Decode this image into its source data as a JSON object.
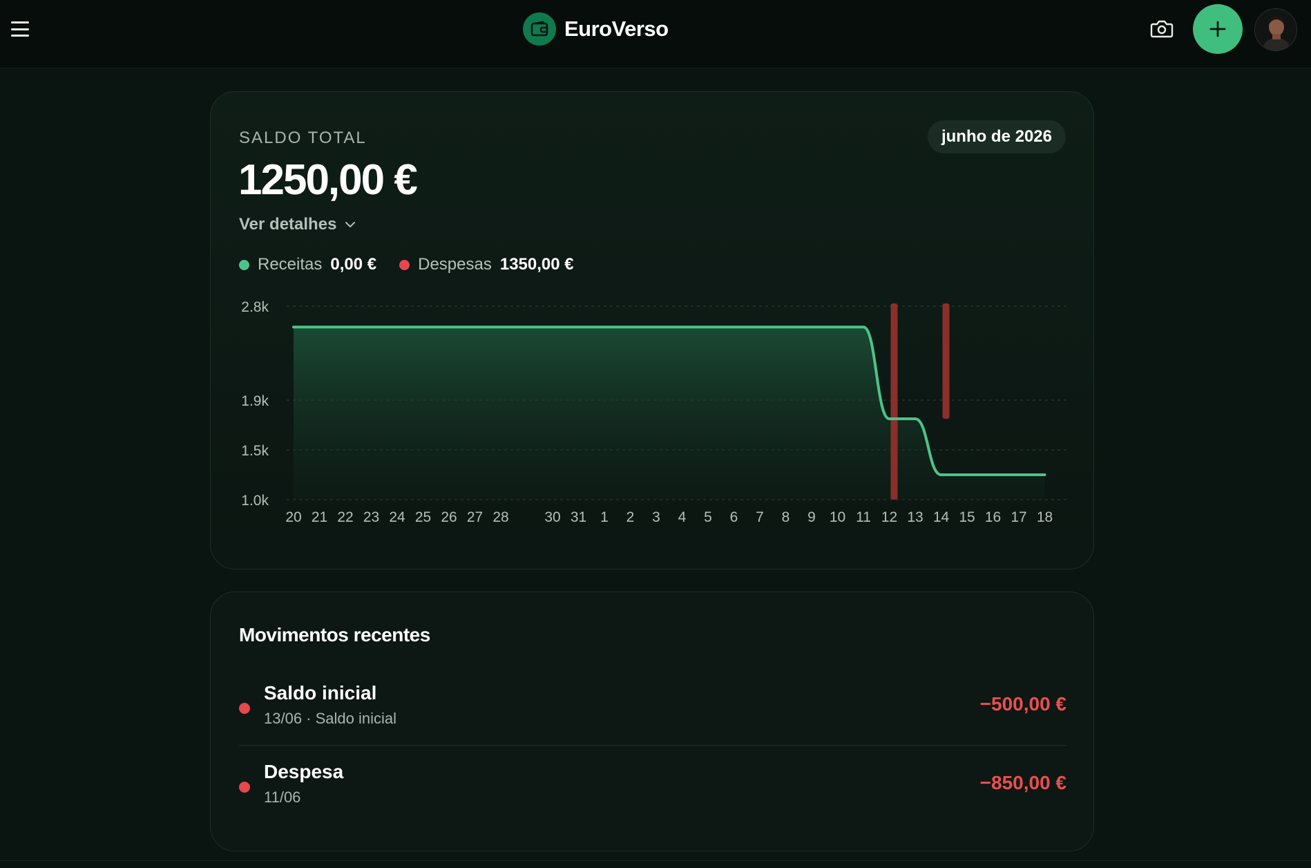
{
  "app": {
    "name": "EuroVerso",
    "accent_color": "#3fbe7d",
    "expense_color": "#e5484d"
  },
  "header": {
    "menu_icon": "hamburger-menu-icon",
    "logo_icon": "wallet-icon",
    "camera_icon": "camera-icon",
    "add_icon": "plus-icon",
    "avatar_icon": "user-avatar"
  },
  "balance": {
    "label": "SALDO TOTAL",
    "value": "1250,00 €",
    "month": "junho de 2026",
    "details_label": "Ver detalhes",
    "income_label": "Receitas",
    "income_value": "0,00 €",
    "expense_label": "Despesas",
    "expense_value": "1350,00 €"
  },
  "chart_data": {
    "type": "line",
    "title": "",
    "xlabel": "",
    "ylabel": "",
    "y_tick_labels": [
      "2.8k",
      "1.9k",
      "1.5k",
      "1.0k"
    ],
    "y_tick_values": [
      2800,
      1900,
      1500,
      1000
    ],
    "x_tick_labels": [
      "20",
      "21",
      "22",
      "23",
      "24",
      "25",
      "26",
      "27",
      "28",
      "30",
      "31",
      "1",
      "2",
      "3",
      "4",
      "5",
      "6",
      "7",
      "8",
      "9",
      "10",
      "11",
      "12",
      "13",
      "14",
      "15",
      "16",
      "17",
      "18"
    ],
    "grid": true,
    "series": [
      {
        "color": "#4cc488",
        "fill": true,
        "x": [
          "20",
          "21",
          "22",
          "23",
          "24",
          "25",
          "26",
          "27",
          "28",
          "30",
          "31",
          "1",
          "2",
          "3",
          "4",
          "5",
          "6",
          "7",
          "8",
          "9",
          "10",
          "11",
          "12",
          "13",
          "14",
          "15",
          "16",
          "17",
          "18"
        ],
        "values": [
          2600,
          2600,
          2600,
          2600,
          2600,
          2600,
          2600,
          2600,
          2600,
          2600,
          2600,
          2600,
          2600,
          2600,
          2600,
          2600,
          2600,
          2600,
          2600,
          2600,
          2600,
          2600,
          1750,
          1750,
          1250,
          1250,
          1250,
          1250,
          1250
        ]
      }
    ],
    "bars": [
      {
        "x": "12",
        "from": 1000,
        "to": 2800,
        "color": "#8a2f2b"
      },
      {
        "x": "14",
        "from": 1750,
        "to": 2800,
        "color": "#8a2f2b"
      }
    ]
  },
  "movements": {
    "title": "Movimentos recentes",
    "items": [
      {
        "title": "Saldo inicial",
        "subtitle": "13/06 · Saldo inicial",
        "amount": "−500,00 €"
      },
      {
        "title": "Despesa",
        "subtitle": "11/06",
        "amount": "−850,00 €"
      }
    ]
  }
}
